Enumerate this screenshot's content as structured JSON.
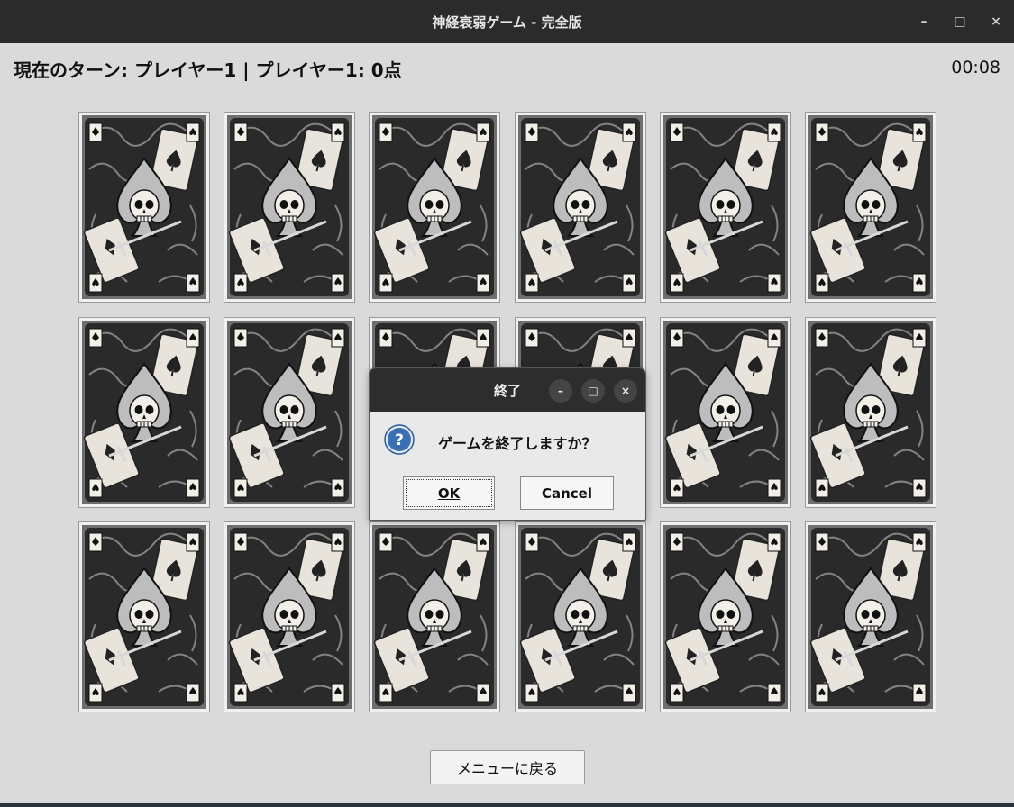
{
  "window": {
    "title": "神経衰弱ゲーム - 完全版",
    "minimize_glyph": "–",
    "maximize_glyph": "□",
    "close_glyph": "×"
  },
  "status": {
    "text": "現在のターン: プレイヤー1 | プレイヤー1: 0点",
    "timer": "00:08"
  },
  "board": {
    "rows": 3,
    "cols": 6,
    "card_state": "face-down",
    "card_back_icon": "skull-spade-card-back-icon"
  },
  "menu_button": {
    "label": "メニューに戻る"
  },
  "dialog": {
    "title": "終了",
    "minimize_glyph": "–",
    "maximize_glyph": "□",
    "close_glyph": "×",
    "message": "ゲームを終了しますか？",
    "icon": "question-icon",
    "ok_label": "OK",
    "cancel_label": "Cancel"
  },
  "colors": {
    "titlebar": "#2b2b2b",
    "background": "#dadada",
    "question_icon": "#3a6fb5"
  }
}
